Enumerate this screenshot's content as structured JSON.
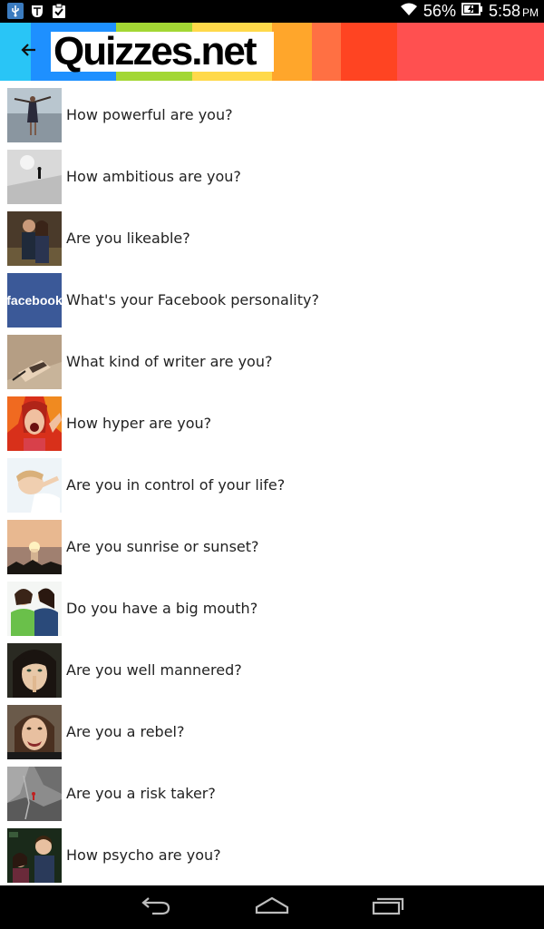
{
  "status_bar": {
    "battery_percent": "56%",
    "time": "5:58",
    "ampm": "PM",
    "icons": [
      "usb-icon",
      "bug-icon",
      "clipboard-check-icon",
      "wifi-icon",
      "battery-charging-icon"
    ]
  },
  "action_bar": {
    "logo_text": "Quizzes.net",
    "back_icon": "back-arrow-icon",
    "stripe_colors": [
      "#29c5f6",
      "#1e90ff",
      "#a3d734",
      "#ffd94a",
      "#ffa62b",
      "#ff7043",
      "#ff4422",
      "#ff5050"
    ]
  },
  "quizzes": [
    {
      "title": "How powerful are you?",
      "thumb": "woman-arms-outstretched-beach"
    },
    {
      "title": "How ambitious are you?",
      "thumb": "climber-in-snow"
    },
    {
      "title": "Are you likeable?",
      "thumb": "smiling-couple"
    },
    {
      "title": "What's your Facebook personality?",
      "thumb": "facebook-logo",
      "thumb_text": "facebook"
    },
    {
      "title": "What kind of writer are you?",
      "thumb": "hand-writing"
    },
    {
      "title": "How hyper are you?",
      "thumb": "screaming-woman-fire"
    },
    {
      "title": "Are you in control of your life?",
      "thumb": "relaxed-child"
    },
    {
      "title": "Are you sunrise or sunset?",
      "thumb": "sunset-over-water"
    },
    {
      "title": "Do you have a big mouth?",
      "thumb": "girls-whispering"
    },
    {
      "title": "Are you well mannered?",
      "thumb": "woman-finger-on-lips"
    },
    {
      "title": "Are you a rebel?",
      "thumb": "woman-snarling"
    },
    {
      "title": "Are you a risk taker?",
      "thumb": "climber-on-rock"
    },
    {
      "title": "How psycho are you?",
      "thumb": "people-at-party"
    }
  ],
  "nav_bar": {
    "icons": [
      "back-nav-icon",
      "home-nav-icon",
      "recent-apps-icon"
    ]
  }
}
